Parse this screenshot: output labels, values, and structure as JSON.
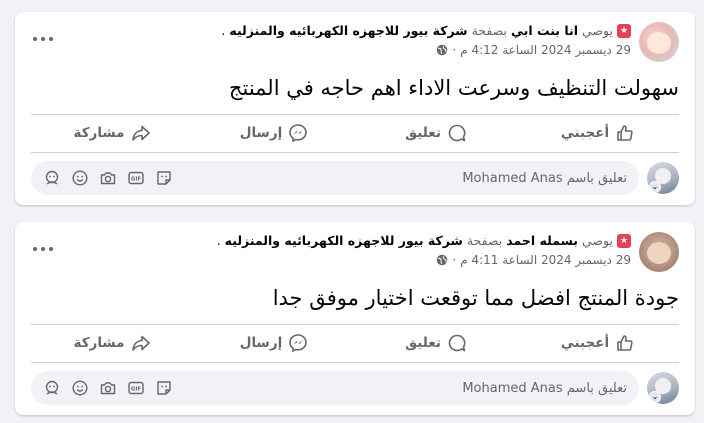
{
  "posts": [
    {
      "role": "يوصي",
      "author": "انا بنت ابي",
      "on_page": "بصفحة",
      "page_name": "شركة بيور للاجهزه الكهربائيه والمنزليه",
      "period": ".",
      "timestamp": "29 ديسمبر 2024 الساعة 4:12 م",
      "separator": "·",
      "body": "سهولت التنظيف وسرعت الاداء اهم حاجه في المنتج",
      "actions": {
        "like": "أعجبني",
        "comment": "تعليق",
        "send": "إرسال",
        "share": "مشاركة"
      },
      "comment_placeholder": "تعليق باسم Mohamed Anas"
    },
    {
      "role": "يوصي",
      "author": "بسمله احمد",
      "on_page": "بصفحة",
      "page_name": "شركة بيور للاجهزه الكهربائيه والمنزليه",
      "period": ".",
      "timestamp": "29 ديسمبر 2024 الساعة 4:11 م",
      "separator": "·",
      "body": "جودة المنتج افضل مما توقعت اختيار موفق جدا",
      "actions": {
        "like": "أعجبني",
        "comment": "تعليق",
        "send": "إرسال",
        "share": "مشاركة"
      },
      "comment_placeholder": "تعليق باسم Mohamed Anas"
    }
  ],
  "icons": {
    "recommend": "star-badge-icon",
    "privacy": "globe-icon",
    "more": "more-options-icon",
    "like": "thumbs-up-icon",
    "comment": "comment-bubble-icon",
    "send": "messenger-icon",
    "share": "share-arrow-icon",
    "emoji": "emoji-icon",
    "camera": "camera-icon",
    "gif": "gif-icon",
    "sticker": "sticker-icon"
  },
  "colors": {
    "recommend_badge": "#e4405f",
    "text_secondary": "#65676b",
    "background": "#f0f2f5"
  }
}
